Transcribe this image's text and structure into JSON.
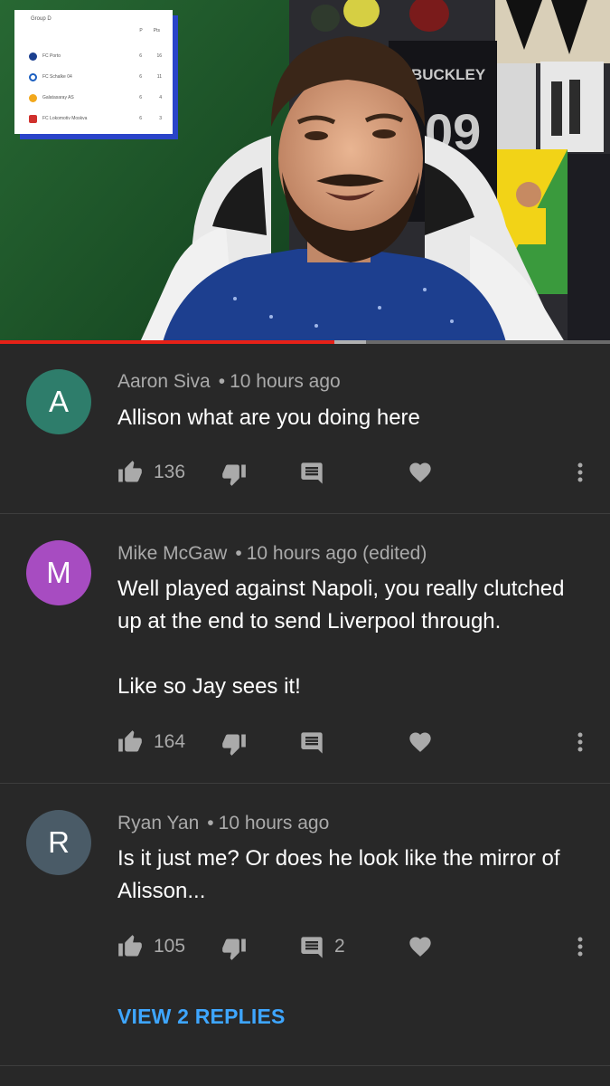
{
  "video": {
    "progress_played": 0.548,
    "progress_buffered": 0.6,
    "standings": {
      "title": "Group D",
      "col_p": "P",
      "col_pts": "Pts",
      "rows": [
        {
          "team": "FC Porto",
          "p": "6",
          "pts": "16"
        },
        {
          "team": "FC Schalke 04",
          "p": "6",
          "pts": "11"
        },
        {
          "team": "Galatasaray AS",
          "p": "6",
          "pts": "4"
        },
        {
          "team": "FC Lokomotiv Moskva",
          "p": "6",
          "pts": "3"
        }
      ]
    },
    "jersey_text": "BUCKLEY",
    "jersey_number": "09"
  },
  "comments": [
    {
      "avatar_letter": "A",
      "avatar_color": "#2e7d6b",
      "author": "Aaron Siva",
      "time": "10 hours ago",
      "text": [
        "Allison what are you doing here"
      ],
      "likes": "136",
      "replies_count": "",
      "view_replies": ""
    },
    {
      "avatar_letter": "M",
      "avatar_color": "#a74cc1",
      "author": "Mike McGaw",
      "time": "10 hours ago (edited)",
      "text": [
        "Well played against Napoli, you really clutched up at the end to send Liverpool through.",
        "Like so Jay sees it!"
      ],
      "likes": "164",
      "replies_count": "",
      "view_replies": ""
    },
    {
      "avatar_letter": "R",
      "avatar_color": "#4a5b67",
      "author": "Ryan Yan",
      "time": "10 hours ago",
      "text": [
        "Is it just me? Or does he look like the mirror of Alisson..."
      ],
      "likes": "105",
      "replies_count": "2",
      "view_replies": "VIEW 2 REPLIES"
    }
  ],
  "icons": {
    "like": "thumb-up-icon",
    "dislike": "thumb-down-icon",
    "reply": "comment-icon",
    "heart": "heart-icon",
    "more": "more-vert-icon"
  },
  "colors": {
    "background": "#282828",
    "secondary_text": "#aaaaaa",
    "link": "#3ea6ff",
    "progress": "#e62117"
  }
}
